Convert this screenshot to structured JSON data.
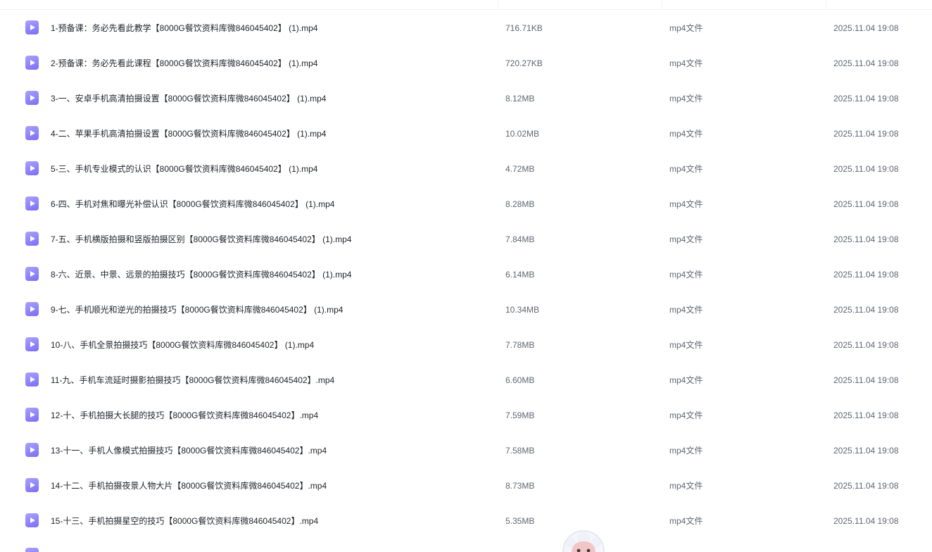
{
  "icons": {
    "file": "video-file-icon",
    "mascot": "assistant-mascot-icon"
  },
  "colors": {
    "icon_accent": "#8b7ff7",
    "name_text": "#1f2329",
    "meta_text": "#5f6572"
  },
  "files": [
    {
      "name": "1-预备课：务必先看此教学【8000G餐饮资料库微846045402】 (1).mp4",
      "size": "716.71KB",
      "type": "mp4文件",
      "modified": "2025.11.04 19:08"
    },
    {
      "name": "2-预备课：务必先看此课程【8000G餐饮资料库微846045402】 (1).mp4",
      "size": "720.27KB",
      "type": "mp4文件",
      "modified": "2025.11.04 19:08"
    },
    {
      "name": "3-一、安卓手机高清拍摄设置【8000G餐饮资料库微846045402】 (1).mp4",
      "size": "8.12MB",
      "type": "mp4文件",
      "modified": "2025.11.04 19:08"
    },
    {
      "name": "4-二、苹果手机高清拍摄设置【8000G餐饮资料库微846045402】 (1).mp4",
      "size": "10.02MB",
      "type": "mp4文件",
      "modified": "2025.11.04 19:08"
    },
    {
      "name": "5-三、手机专业模式的认识【8000G餐饮资料库微846045402】 (1).mp4",
      "size": "4.72MB",
      "type": "mp4文件",
      "modified": "2025.11.04 19:08"
    },
    {
      "name": "6-四、手机对焦和曝光补偿认识【8000G餐饮资料库微846045402】 (1).mp4",
      "size": "8.28MB",
      "type": "mp4文件",
      "modified": "2025.11.04 19:08"
    },
    {
      "name": "7-五、手机横版拍摄和竖版拍摄区别【8000G餐饮资料库微846045402】 (1).mp4",
      "size": "7.84MB",
      "type": "mp4文件",
      "modified": "2025.11.04 19:08"
    },
    {
      "name": "8-六、近景、中景、远景的拍摄技巧【8000G餐饮资料库微846045402】 (1).mp4",
      "size": "6.14MB",
      "type": "mp4文件",
      "modified": "2025.11.04 19:08"
    },
    {
      "name": "9-七、手机顺光和逆光的拍摄技巧【8000G餐饮资料库微846045402】 (1).mp4",
      "size": "10.34MB",
      "type": "mp4文件",
      "modified": "2025.11.04 19:08"
    },
    {
      "name": "10-八、手机全景拍摄技巧【8000G餐饮资料库微846045402】 (1).mp4",
      "size": "7.78MB",
      "type": "mp4文件",
      "modified": "2025.11.04 19:08"
    },
    {
      "name": "11-九、手机车流延时摄影拍摄技巧【8000G餐饮资料库微846045402】.mp4",
      "size": "6.60MB",
      "type": "mp4文件",
      "modified": "2025.11.04 19:08"
    },
    {
      "name": "12-十、手机拍摄大长腿的技巧【8000G餐饮资料库微846045402】.mp4",
      "size": "7.59MB",
      "type": "mp4文件",
      "modified": "2025.11.04 19:08"
    },
    {
      "name": "13-十一、手机人像模式拍摄技巧【8000G餐饮资料库微846045402】.mp4",
      "size": "7.58MB",
      "type": "mp4文件",
      "modified": "2025.11.04 19:08"
    },
    {
      "name": "14-十二、手机拍摄夜景人物大片【8000G餐饮资料库微846045402】.mp4",
      "size": "8.73MB",
      "type": "mp4文件",
      "modified": "2025.11.04 19:08"
    },
    {
      "name": "15-十三、手机拍摄星空的技巧【8000G餐饮资料库微846045402】.mp4",
      "size": "5.35MB",
      "type": "mp4文件",
      "modified": "2025.11.04 19:08"
    }
  ]
}
